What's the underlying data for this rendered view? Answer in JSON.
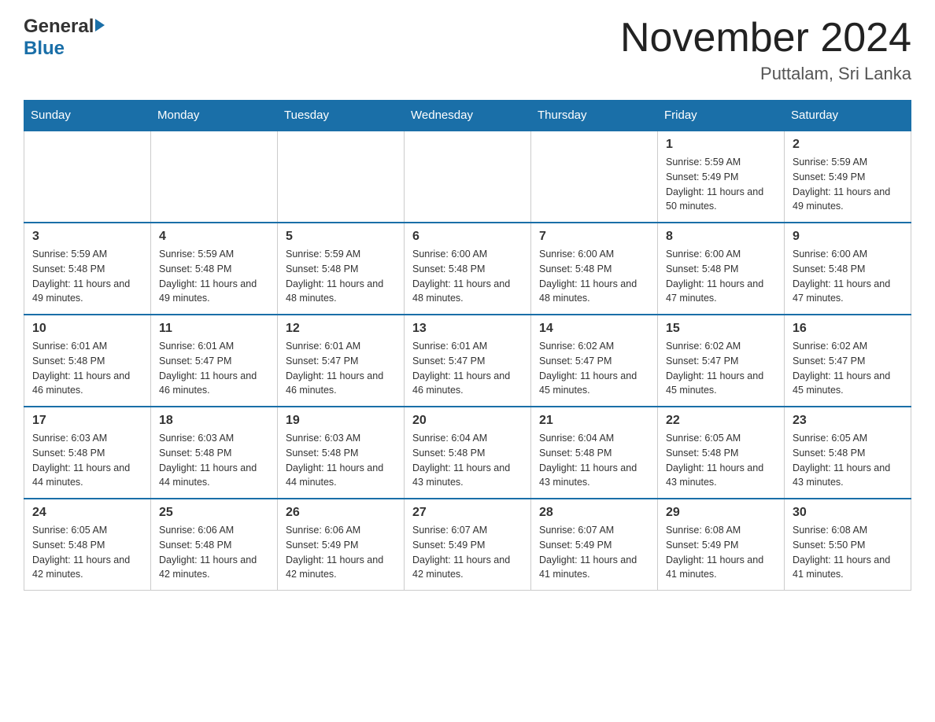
{
  "header": {
    "logo_general": "General",
    "logo_blue": "Blue",
    "month_title": "November 2024",
    "location": "Puttalam, Sri Lanka"
  },
  "weekdays": [
    "Sunday",
    "Monday",
    "Tuesday",
    "Wednesday",
    "Thursday",
    "Friday",
    "Saturday"
  ],
  "weeks": [
    [
      {
        "day": "",
        "info": ""
      },
      {
        "day": "",
        "info": ""
      },
      {
        "day": "",
        "info": ""
      },
      {
        "day": "",
        "info": ""
      },
      {
        "day": "",
        "info": ""
      },
      {
        "day": "1",
        "info": "Sunrise: 5:59 AM\nSunset: 5:49 PM\nDaylight: 11 hours and 50 minutes."
      },
      {
        "day": "2",
        "info": "Sunrise: 5:59 AM\nSunset: 5:49 PM\nDaylight: 11 hours and 49 minutes."
      }
    ],
    [
      {
        "day": "3",
        "info": "Sunrise: 5:59 AM\nSunset: 5:48 PM\nDaylight: 11 hours and 49 minutes."
      },
      {
        "day": "4",
        "info": "Sunrise: 5:59 AM\nSunset: 5:48 PM\nDaylight: 11 hours and 49 minutes."
      },
      {
        "day": "5",
        "info": "Sunrise: 5:59 AM\nSunset: 5:48 PM\nDaylight: 11 hours and 48 minutes."
      },
      {
        "day": "6",
        "info": "Sunrise: 6:00 AM\nSunset: 5:48 PM\nDaylight: 11 hours and 48 minutes."
      },
      {
        "day": "7",
        "info": "Sunrise: 6:00 AM\nSunset: 5:48 PM\nDaylight: 11 hours and 48 minutes."
      },
      {
        "day": "8",
        "info": "Sunrise: 6:00 AM\nSunset: 5:48 PM\nDaylight: 11 hours and 47 minutes."
      },
      {
        "day": "9",
        "info": "Sunrise: 6:00 AM\nSunset: 5:48 PM\nDaylight: 11 hours and 47 minutes."
      }
    ],
    [
      {
        "day": "10",
        "info": "Sunrise: 6:01 AM\nSunset: 5:48 PM\nDaylight: 11 hours and 46 minutes."
      },
      {
        "day": "11",
        "info": "Sunrise: 6:01 AM\nSunset: 5:47 PM\nDaylight: 11 hours and 46 minutes."
      },
      {
        "day": "12",
        "info": "Sunrise: 6:01 AM\nSunset: 5:47 PM\nDaylight: 11 hours and 46 minutes."
      },
      {
        "day": "13",
        "info": "Sunrise: 6:01 AM\nSunset: 5:47 PM\nDaylight: 11 hours and 46 minutes."
      },
      {
        "day": "14",
        "info": "Sunrise: 6:02 AM\nSunset: 5:47 PM\nDaylight: 11 hours and 45 minutes."
      },
      {
        "day": "15",
        "info": "Sunrise: 6:02 AM\nSunset: 5:47 PM\nDaylight: 11 hours and 45 minutes."
      },
      {
        "day": "16",
        "info": "Sunrise: 6:02 AM\nSunset: 5:47 PM\nDaylight: 11 hours and 45 minutes."
      }
    ],
    [
      {
        "day": "17",
        "info": "Sunrise: 6:03 AM\nSunset: 5:48 PM\nDaylight: 11 hours and 44 minutes."
      },
      {
        "day": "18",
        "info": "Sunrise: 6:03 AM\nSunset: 5:48 PM\nDaylight: 11 hours and 44 minutes."
      },
      {
        "day": "19",
        "info": "Sunrise: 6:03 AM\nSunset: 5:48 PM\nDaylight: 11 hours and 44 minutes."
      },
      {
        "day": "20",
        "info": "Sunrise: 6:04 AM\nSunset: 5:48 PM\nDaylight: 11 hours and 43 minutes."
      },
      {
        "day": "21",
        "info": "Sunrise: 6:04 AM\nSunset: 5:48 PM\nDaylight: 11 hours and 43 minutes."
      },
      {
        "day": "22",
        "info": "Sunrise: 6:05 AM\nSunset: 5:48 PM\nDaylight: 11 hours and 43 minutes."
      },
      {
        "day": "23",
        "info": "Sunrise: 6:05 AM\nSunset: 5:48 PM\nDaylight: 11 hours and 43 minutes."
      }
    ],
    [
      {
        "day": "24",
        "info": "Sunrise: 6:05 AM\nSunset: 5:48 PM\nDaylight: 11 hours and 42 minutes."
      },
      {
        "day": "25",
        "info": "Sunrise: 6:06 AM\nSunset: 5:48 PM\nDaylight: 11 hours and 42 minutes."
      },
      {
        "day": "26",
        "info": "Sunrise: 6:06 AM\nSunset: 5:49 PM\nDaylight: 11 hours and 42 minutes."
      },
      {
        "day": "27",
        "info": "Sunrise: 6:07 AM\nSunset: 5:49 PM\nDaylight: 11 hours and 42 minutes."
      },
      {
        "day": "28",
        "info": "Sunrise: 6:07 AM\nSunset: 5:49 PM\nDaylight: 11 hours and 41 minutes."
      },
      {
        "day": "29",
        "info": "Sunrise: 6:08 AM\nSunset: 5:49 PM\nDaylight: 11 hours and 41 minutes."
      },
      {
        "day": "30",
        "info": "Sunrise: 6:08 AM\nSunset: 5:50 PM\nDaylight: 11 hours and 41 minutes."
      }
    ]
  ]
}
